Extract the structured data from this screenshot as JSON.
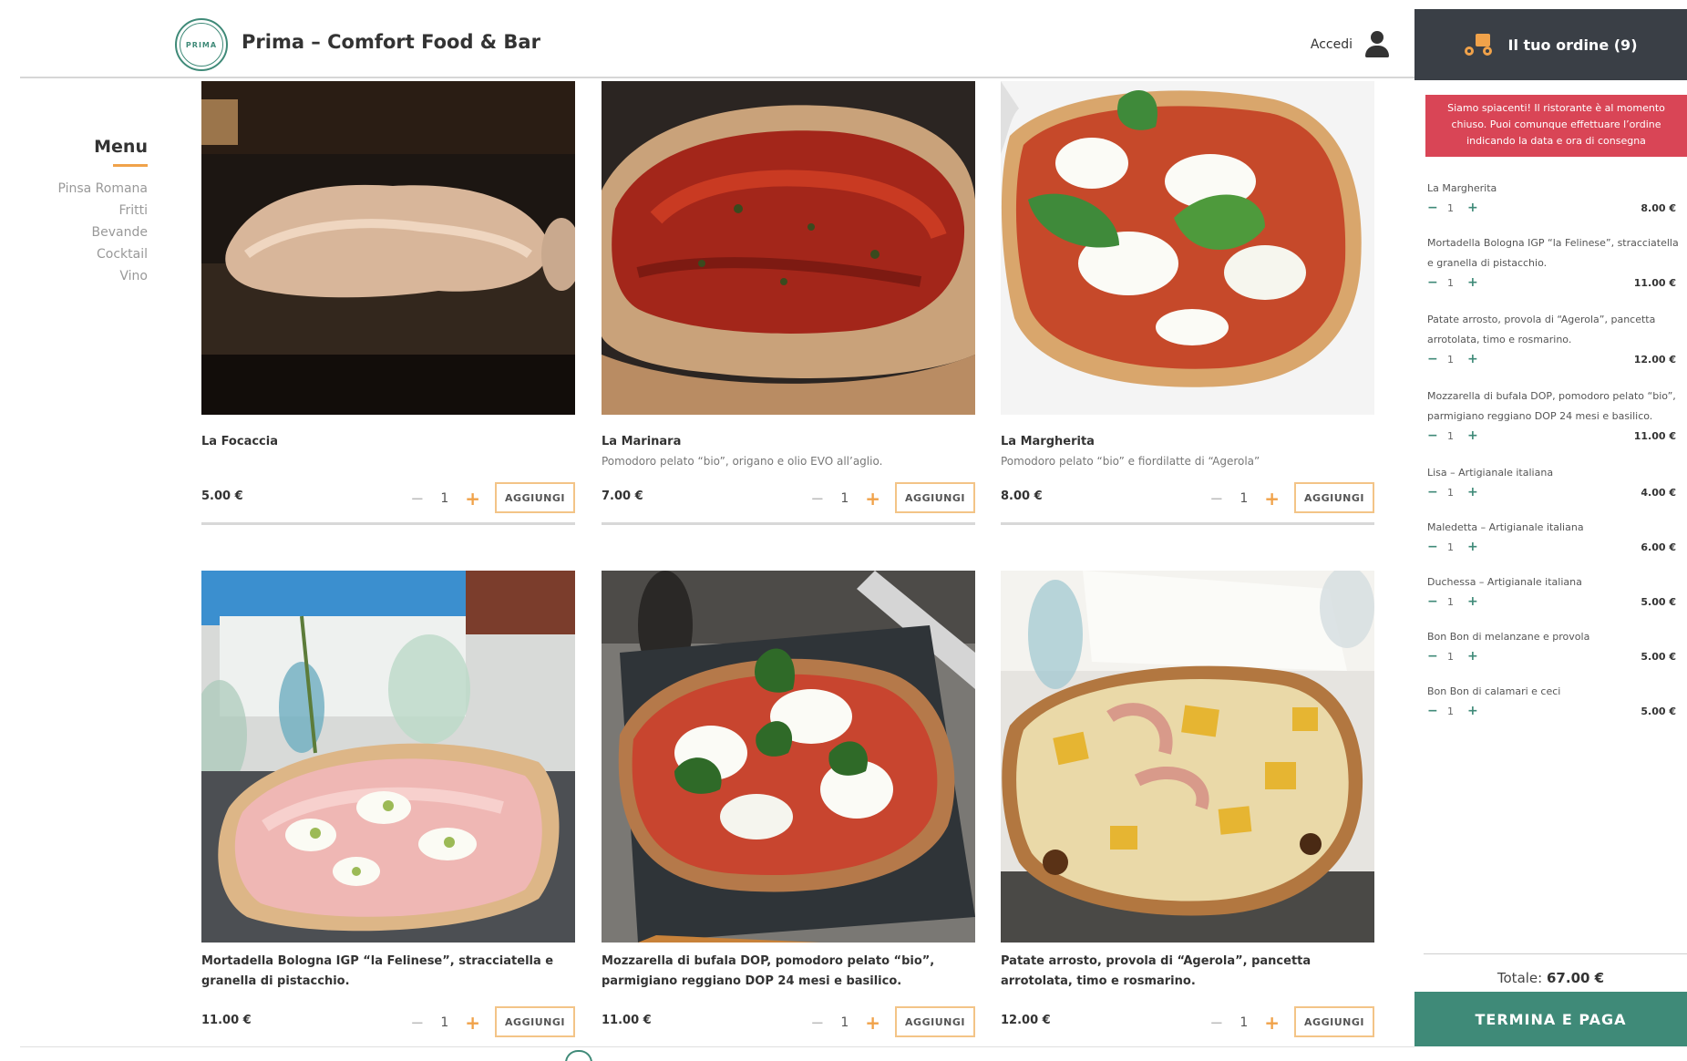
{
  "header": {
    "logo_text": "PRIMA",
    "title": "Prima – Comfort Food & Bar",
    "login_label": "Accedi"
  },
  "menu": {
    "title": "Menu",
    "items": [
      "Pinsa Romana",
      "Fritti",
      "Bevande",
      "Cocktail",
      "Vino"
    ]
  },
  "products": [
    {
      "name": "La Focaccia",
      "description": "",
      "price": "5.00 €",
      "qty": "1"
    },
    {
      "name": "La Marinara",
      "description": "Pomodoro pelato “bio”, origano e olio EVO all’aglio.",
      "price": "7.00 €",
      "qty": "1"
    },
    {
      "name": "La Margherita",
      "description": "Pomodoro pelato “bio” e fiordilatte di “Agerola”",
      "price": "8.00 €",
      "qty": "1"
    },
    {
      "name": "Mortadella Bologna IGP “la Felinese”, stracciatella e granella di pistacchio.",
      "description": "",
      "price": "11.00 €",
      "qty": "1"
    },
    {
      "name": "Mozzarella di bufala DOP, pomodoro pelato “bio”, parmigiano reggiano DOP 24 mesi e basilico.",
      "description": "",
      "price": "11.00 €",
      "qty": "1"
    },
    {
      "name": "Patate arrosto, provola di “Agerola”, pancetta arrotolata, timo e rosmarino.",
      "description": "",
      "price": "12.00 €",
      "qty": "1"
    }
  ],
  "buttons": {
    "add_label": "AGGIUNGI",
    "minus": "−",
    "plus": "+"
  },
  "cart": {
    "title": "Il tuo ordine (9)",
    "closed_message": "Siamo spiacenti! Il ristorante è al momento chiuso. Puoi comunque effettuare l’ordine indicando la data e ora di consegna",
    "items": [
      {
        "name": "La Margherita",
        "qty": "1",
        "price": "8.00 €"
      },
      {
        "name": "Mortadella Bologna IGP “la Felinese”, stracciatella e granella di pistacchio.",
        "qty": "1",
        "price": "11.00 €"
      },
      {
        "name": "Patate arrosto, provola di “Agerola”, pancetta arrotolata, timo e rosmarino.",
        "qty": "1",
        "price": "12.00 €"
      },
      {
        "name": "Mozzarella di bufala DOP, pomodoro pelato “bio”, parmigiano reggiano DOP 24 mesi e basilico.",
        "qty": "1",
        "price": "11.00 €"
      },
      {
        "name": "Lisa – Artigianale italiana",
        "qty": "1",
        "price": "4.00 €"
      },
      {
        "name": "Maledetta – Artigianale italiana",
        "qty": "1",
        "price": "6.00 €"
      },
      {
        "name": "Duchessa – Artigianale italiana",
        "qty": "1",
        "price": "5.00 €"
      },
      {
        "name": "Bon Bon di melanzane e provola",
        "qty": "1",
        "price": "5.00 €"
      },
      {
        "name": "Bon Bon di calamari e ceci",
        "qty": "1",
        "price": "5.00 €"
      }
    ],
    "total_label": "Totale:",
    "total_value": "67.00 €",
    "pay_label": "TERMINA E PAGA"
  },
  "colors": {
    "accent": "#f0a24a",
    "brand_green": "#3f8a78",
    "header_dark": "#3a3f46",
    "alert_red": "#d94556"
  },
  "icons": {
    "user": "user-icon",
    "delivery": "delivery-bike-icon"
  }
}
